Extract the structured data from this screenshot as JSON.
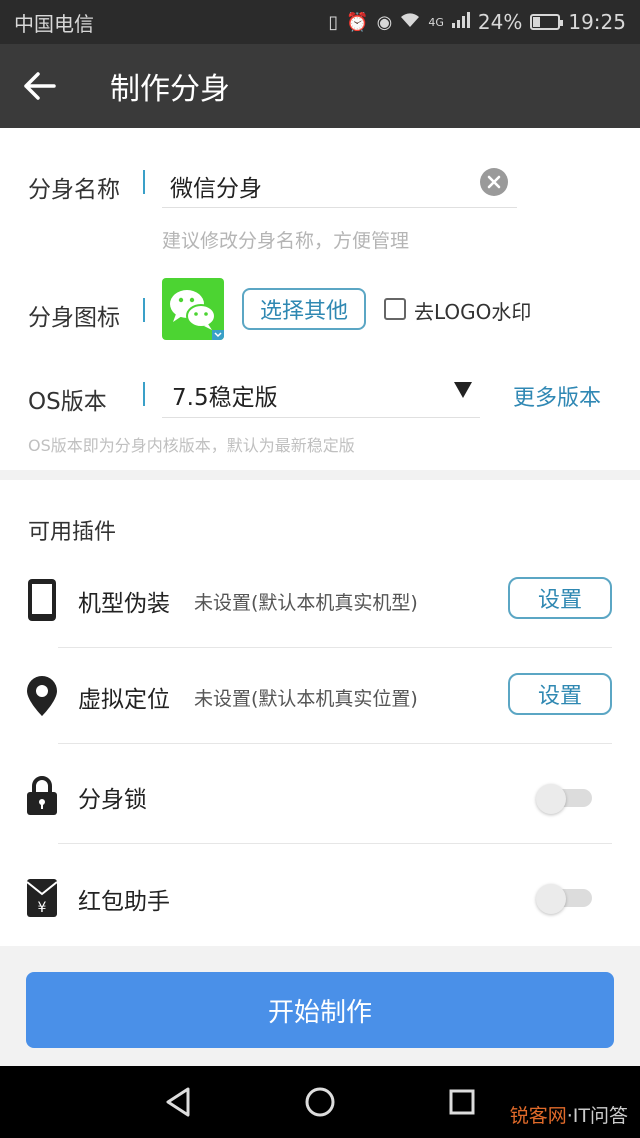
{
  "status_bar": {
    "carrier": "中国电信",
    "network": "4G",
    "battery": "24%",
    "battery_level": 0.24,
    "time": "19:25"
  },
  "toolbar": {
    "title": "制作分身",
    "back_icon": "arrow-left-icon"
  },
  "clone_settings": {
    "name_label": "分身名称",
    "name_value": "微信分身",
    "name_hint": "建议修改分身名称，方便管理",
    "icon_label": "分身图标",
    "choose_other": "选择其他",
    "remove_logo": "去LOGO水印",
    "remove_logo_checked": false,
    "os_label": "OS版本",
    "os_value": "7.5稳定版",
    "more_versions": "更多版本",
    "os_hint": "OS版本即为分身内核版本，默认为最新稳定版"
  },
  "plugins": {
    "title": "可用插件",
    "device_spoof": {
      "label": "机型伪装",
      "desc": "未设置(默认本机真实机型)",
      "button": "设置",
      "icon": "phone-icon"
    },
    "virtual_location": {
      "label": "虚拟定位",
      "desc": "未设置(默认本机真实位置)",
      "button": "设置",
      "icon": "location-pin-icon"
    },
    "clone_lock": {
      "label": "分身锁",
      "enabled": false,
      "icon": "lock-icon"
    },
    "red_packet": {
      "label": "红包助手",
      "enabled": false,
      "icon": "red-packet-icon"
    }
  },
  "start_button": "开始制作",
  "colors": {
    "accent_blue": "#4a90e8",
    "link_blue": "#3088b4",
    "toolbar": "#3a3a3a",
    "wechat_green": "#4cd432"
  },
  "watermark": {
    "brand": "锐客网",
    "suffix": "·IT问答"
  }
}
